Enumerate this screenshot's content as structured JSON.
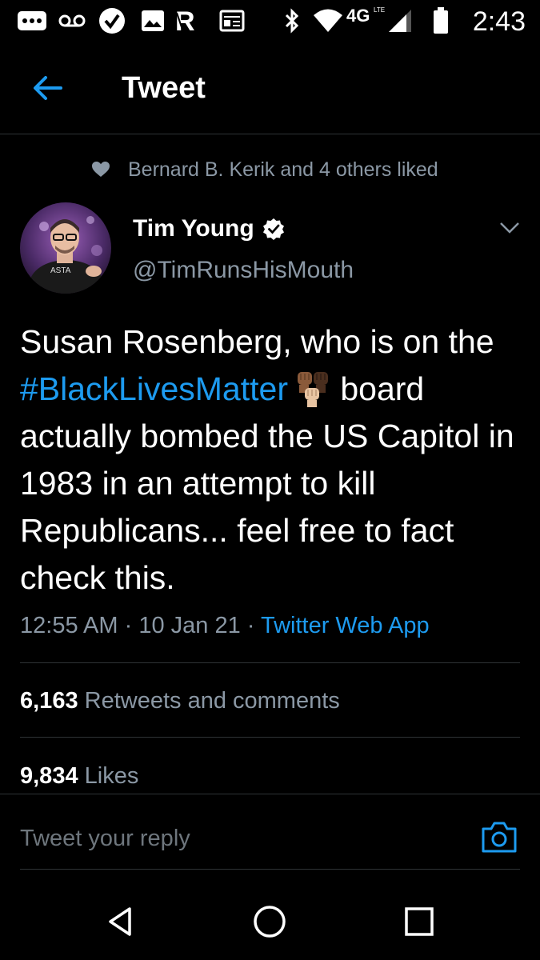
{
  "status_bar": {
    "time": "2:43",
    "network": "4G",
    "icons": [
      "more-icon",
      "voicemail-icon",
      "check-icon",
      "image-icon",
      "r-app-icon",
      "news-icon",
      "bluetooth-icon",
      "wifi-icon",
      "signal-icon",
      "battery-icon"
    ]
  },
  "header": {
    "title": "Tweet",
    "back_icon": "arrow-left-icon",
    "accent": "#1d9bf0"
  },
  "social_context": {
    "text": "Bernard B. Kerik and 4 others liked",
    "icon": "heart-icon"
  },
  "author": {
    "name": "Tim Young",
    "handle": "@TimRunsHisMouth",
    "verified": true,
    "avatar_shirt_text": "ASTA"
  },
  "tweet": {
    "text_before": "Susan Rosenberg, who is on the ",
    "hashtag": "#BlackLivesMatter",
    "text_after": " board actually bombed the US Capitol in 1983 in an attempt to kill Republicans...  feel free to fact check this.",
    "emoji": "raised-fists-emoji"
  },
  "meta": {
    "time": "12:55 AM",
    "date": "10 Jan 21",
    "separator": " · ",
    "source": "Twitter Web App"
  },
  "stats": {
    "retweets_count": "6,163",
    "retweets_label": "Retweets and comments",
    "likes_count": "9,834",
    "likes_label": "Likes"
  },
  "reply": {
    "placeholder": "Tweet your reply",
    "camera_icon": "camera-icon"
  },
  "nav": {
    "icons": [
      "back-triangle-icon",
      "home-circle-icon",
      "recents-square-icon"
    ]
  },
  "colors": {
    "background": "#000000",
    "secondary_text": "#8b98a5",
    "link": "#1d9bf0",
    "divider": "#2f3336"
  }
}
